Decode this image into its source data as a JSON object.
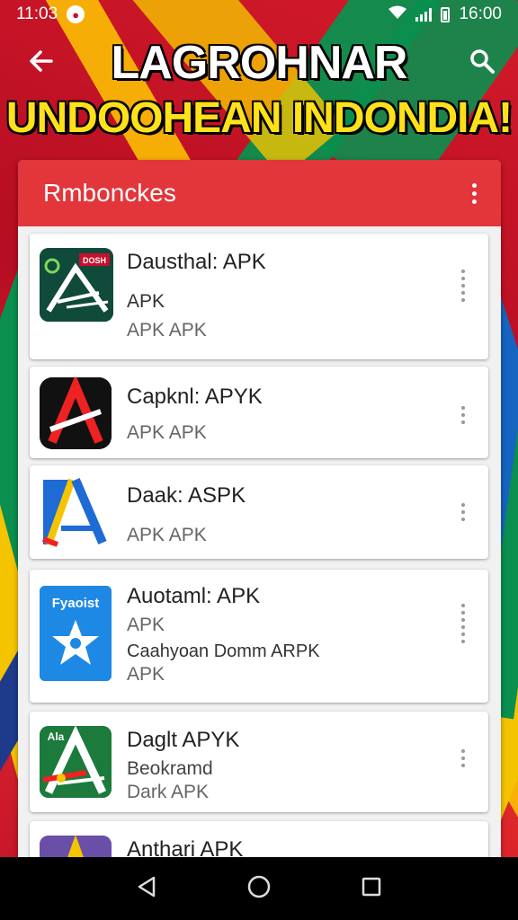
{
  "status_bar": {
    "time_left": "11:03",
    "time_right": "16:00",
    "notification_icon": "circle-notification-icon",
    "wifi_icon": "wifi-icon",
    "signal_icon": "signal-icon",
    "battery_icon": "battery-icon"
  },
  "app_bar": {
    "title_line1": "LAGROHNAR",
    "title_line2": "UNDOOHEAN INDONDIA!",
    "back_icon": "arrow-left-icon",
    "search_icon": "search-icon"
  },
  "panel": {
    "title": "Rmbonckes",
    "menu_icon": "more-vertical-icon"
  },
  "apps": [
    {
      "name": "Dausthal: APK",
      "line2": "APK",
      "line3": "APK APK",
      "icon": "dark-green-a-icon",
      "icon_badge": "DOSH"
    },
    {
      "name": "Capknl: APYK",
      "line2": "APK APK",
      "line3": "",
      "icon": "red-a-black-icon",
      "icon_badge": ""
    },
    {
      "name": "Daak: ASPK",
      "line2": "APK APK",
      "line3": "",
      "icon": "blue-yellow-a-icon",
      "icon_badge": ""
    },
    {
      "name": "Auotaml: APK",
      "line2": "APK",
      "line3": "Caahyoan Domm ARPK",
      "line4": "APK",
      "icon": "blue-star-icon",
      "icon_badge": "Fyaoist"
    },
    {
      "name": "Daglt APYK",
      "line2": "Beokramd",
      "line3": "Dark APK",
      "icon": "green-a-icon",
      "icon_badge": "Ala"
    },
    {
      "name": "Anthari APK",
      "line2": "",
      "line3": "",
      "icon": "purple-a-icon",
      "icon_badge": ""
    }
  ],
  "nav_bar": {
    "back_icon": "nav-back-triangle-icon",
    "home_icon": "nav-home-circle-icon",
    "recents_icon": "nav-recents-square-icon"
  },
  "colors": {
    "header_red": "#e2363b",
    "title_yellow": "#ffe11a",
    "bg_red": "#c8102e"
  }
}
